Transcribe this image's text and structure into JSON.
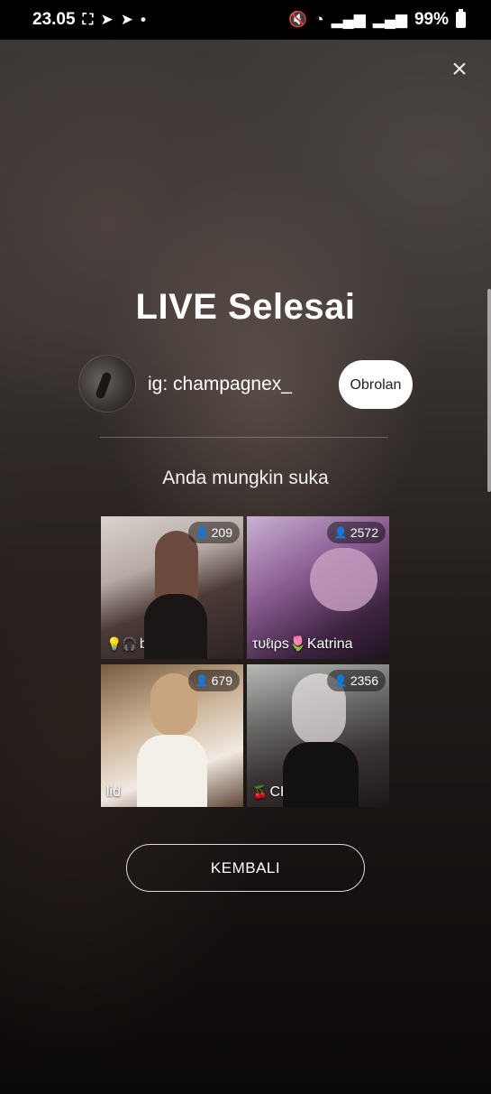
{
  "status_bar": {
    "time": "23.05",
    "left_icons": [
      "screenshot-icon",
      "telegram-icon",
      "telegram-icon",
      "dot-icon"
    ],
    "right_icons": [
      "mute-icon",
      "wifi-icon",
      "signal-icon",
      "signal-icon"
    ],
    "battery": "99%"
  },
  "close_icon": "×",
  "title": "LIVE Selesai",
  "host": {
    "name": "ig: champagnex_",
    "chat_button": "Obrolan"
  },
  "suggestions": {
    "heading": "Anda mungkin suka",
    "cards": [
      {
        "viewers": "209",
        "prefix": "💡🎧",
        "name": "bbyJey"
      },
      {
        "viewers": "2572",
        "prefix": "",
        "name": "τυℓιρѕ🌷Katrina"
      },
      {
        "viewers": "679",
        "prefix": "",
        "name": "lid"
      },
      {
        "viewers": "2356",
        "prefix": "🍒",
        "name": "CHERRY⚠️"
      }
    ]
  },
  "back_button": "KEMBALI",
  "colors": {
    "background_top": "#3d3836",
    "background_bottom": "#0c0a09",
    "chat_button_bg": "#ffffff",
    "text": "#ffffff"
  }
}
